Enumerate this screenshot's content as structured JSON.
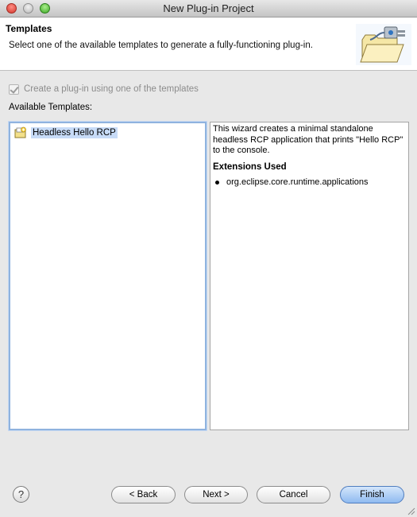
{
  "window": {
    "title": "New Plug-in Project"
  },
  "banner": {
    "title": "Templates",
    "description": "Select one of the available templates to generate a fully-functioning plug-in.",
    "icon": "plugin-folder-wizard-icon"
  },
  "options": {
    "use_template_label": "Create a plug-in using one of the templates",
    "use_template_checked": true,
    "use_template_enabled": false
  },
  "templates": {
    "label": "Available Templates:",
    "items": [
      {
        "label": "Headless Hello RCP",
        "icon": "template-icon",
        "selected": true
      }
    ]
  },
  "description": {
    "text": "This wizard creates a minimal standalone headless RCP application that prints \"Hello RCP\" to the console.",
    "extensions_heading": "Extensions Used",
    "extensions": [
      "org.eclipse.core.runtime.applications"
    ]
  },
  "buttons": {
    "help": "?",
    "back": "< Back",
    "next": "Next >",
    "cancel": "Cancel",
    "finish": "Finish"
  }
}
